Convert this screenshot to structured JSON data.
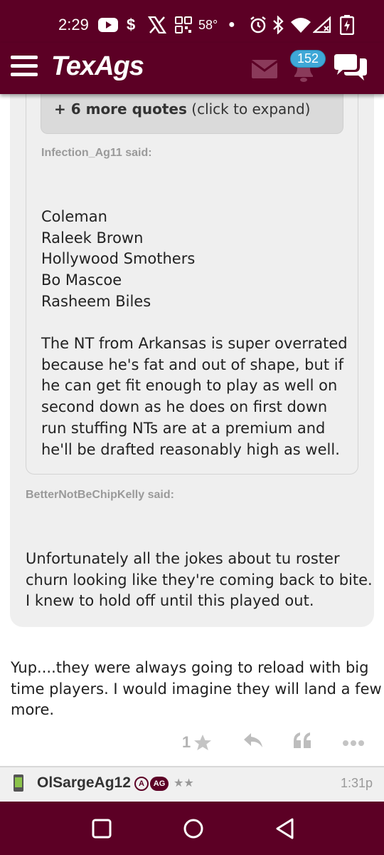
{
  "status_bar": {
    "time": "2:29",
    "temperature": "58°",
    "icons": [
      "youtube-icon",
      "dollar-icon",
      "x-icon",
      "grid-icon",
      "alarm-icon",
      "bluetooth-icon",
      "wifi-icon",
      "signal-icon",
      "battery-icon"
    ]
  },
  "header": {
    "logo": "TexAgs",
    "notification_count": "152",
    "brand_color": "#5c0025",
    "badge_color": "#3fa8d7"
  },
  "quotes": {
    "expand": {
      "bold": "+ 6 more quotes",
      "rest": " (click to expand)"
    },
    "inner": {
      "author_said": "Infection_Ag11 said:",
      "names": [
        "Coleman",
        "Raleek Brown",
        "Hollywood Smothers",
        "Bo Mascoe",
        "Rasheem Biles"
      ],
      "paragraph_lines": [
        "The NT from Arkansas is super overrated",
        "because he's fat and out of shape, but if",
        "he can get fit enough to play as well on",
        "second down as he does on first down",
        "run stuffing NTs are at a premium and",
        "he'll be drafted reasonably high as well."
      ]
    },
    "outer": {
      "author_said": "BetterNotBeChipKelly said:",
      "lines": [
        "Unfortunately all the jokes about tu roster",
        "churn looking like they're coming back to bite.",
        "I knew to hold off until this played out."
      ]
    }
  },
  "post": {
    "lines": [
      "Yup....they were always going to reload with big",
      "time players. I would imagine they will land a few",
      "more."
    ],
    "rating": "1",
    "actions": [
      "star-icon",
      "reply-icon",
      "quote-icon",
      "more-icon"
    ]
  },
  "next_post": {
    "username": "OlSargeAg12",
    "badge_a": "A",
    "badge_ag": "AG",
    "stars": "★★",
    "time": "1:31p"
  },
  "nav_bar": {
    "buttons": [
      "recent-apps-button",
      "home-button",
      "back-button"
    ]
  }
}
